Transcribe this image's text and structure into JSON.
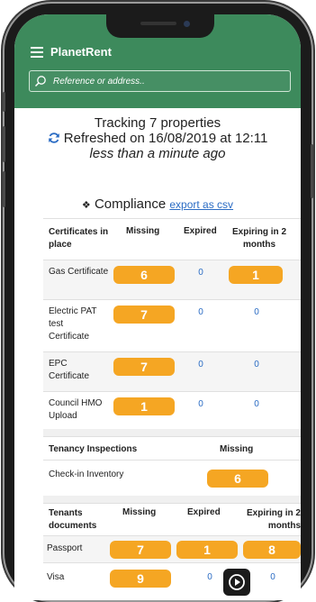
{
  "app": {
    "title": "PlanetRent",
    "search_placeholder": "Reference or address..",
    "accent_color": "#3d8a5c",
    "pill_color": "#f5a623"
  },
  "tracking": {
    "line1": "Tracking 7 properties",
    "line2": "Refreshed on 16/08/2019 at 12:11",
    "line3": "less than a minute ago"
  },
  "compliance": {
    "title": "Compliance",
    "export_link": "export as csv",
    "headers": [
      "Certificates in place",
      "Missing",
      "Expired",
      "Expiring in 2 months"
    ],
    "rows": [
      {
        "label": "Gas Certificate",
        "missing": "6",
        "expired": "0",
        "expiring": "1"
      },
      {
        "label": "Electric PAT test Certificate",
        "missing": "7",
        "expired": "0",
        "expiring": "0"
      },
      {
        "label": "EPC Certificate",
        "missing": "7",
        "expired": "0",
        "expiring": "0"
      },
      {
        "label": "Council HMO Upload",
        "missing": "1",
        "expired": "0",
        "expiring": "0"
      }
    ]
  },
  "inspections": {
    "headers": [
      "Tenancy Inspections",
      "Missing"
    ],
    "rows": [
      {
        "label": "Check-in Inventory",
        "missing": "6"
      }
    ]
  },
  "tenants": {
    "headers": [
      "Tenants documents",
      "Missing",
      "Expired",
      "Expiring in 2 months"
    ],
    "rows": [
      {
        "label": "Passport",
        "missing": "7",
        "expired": "1",
        "expiring": "8"
      },
      {
        "label": "Visa",
        "missing": "9",
        "expired": "0",
        "expiring": "0"
      }
    ]
  },
  "icons": {
    "menu": "hamburger-icon",
    "search": "search-icon",
    "refresh": "refresh-icon",
    "home": "home-icon",
    "play": "play-icon"
  }
}
